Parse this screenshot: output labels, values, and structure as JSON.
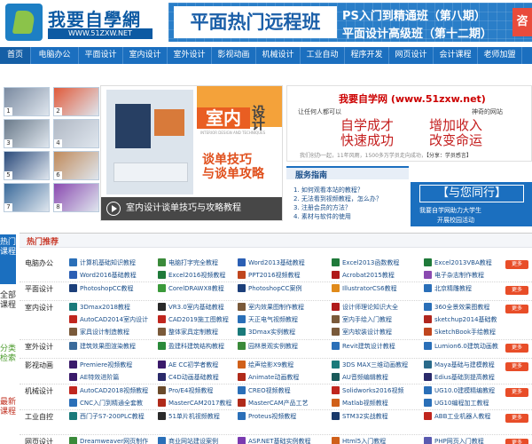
{
  "header": {
    "logo_title": "我要自學網",
    "logo_url": "WWW.51ZXW.NET",
    "banner_main": "平面热门远程班",
    "banner_line1": "PS入门到精通班（第八期）",
    "banner_line2": "平面设计高级班（第十二期）",
    "banner_badge": "咨"
  },
  "nav": [
    "首页",
    "电脑办公",
    "平面设计",
    "室内设计",
    "室外设计",
    "影视动画",
    "机械设计",
    "工业自动",
    "程序开发",
    "网页设计",
    "会计课程",
    "老师加盟",
    "学习辅"
  ],
  "thumb_numbers": [
    "1",
    "2",
    "3",
    "4",
    "5",
    "6",
    "7",
    "8"
  ],
  "slide": {
    "tag": "室内",
    "tag2": "设计",
    "subtitle": "INTERIOR DESIGN AND TECHNIQUES",
    "title1": "谈单技巧",
    "title2": "与谈单攻略",
    "caption": "室内设计谈单技巧与攻略教程"
  },
  "promo": {
    "title": "我要自学网 (www.51zxw.net)",
    "left_label": "让任何人都可以",
    "right_label": "神奇的网站",
    "big1": "自学成才",
    "big2": "快速成功",
    "big3": "增加收入",
    "big4": "改变命运",
    "foot": "我们创办一起，11年风雨，1500多万学员走向成功，",
    "foot_bold": "【分享：学员感言】"
  },
  "service": {
    "title": "服务指南",
    "items": [
      "1. 如何观看本站的教程？",
      "2. 无法看到视频教程，怎么办？",
      "3. 注册会员的方法？",
      "4. 素材与软件的使用"
    ]
  },
  "together": {
    "title": "【与您同行】",
    "line1": "我要自学网助力大学生",
    "line2": "开展校园活动"
  },
  "side_tabs": [
    "热门课程",
    "全部课程",
    "分类检索",
    "最新课程"
  ],
  "hot": {
    "title": "热门推荐",
    "more_label": "更多",
    "rows": [
      {
        "cat": "电脑办公",
        "items": [
          [
            "计算机基础知识教程",
            "#2a6fb8"
          ],
          [
            "电脑打字完全教程",
            "#3a8a3a"
          ],
          [
            "Word2013基础教程",
            "#2b5fb4"
          ],
          [
            "Excel2013函数教程",
            "#1f7a3a"
          ],
          [
            "Excel2013VBA教程",
            "#1f7a3a"
          ],
          [
            "Word2016基础教程",
            "#2b5fb4"
          ],
          [
            "Excel2016视频教程",
            "#1f7a3a"
          ],
          [
            "PPT2016视频教程",
            "#c0461e"
          ],
          [
            "Acrobat2015教程",
            "#b01a1a"
          ],
          [
            "电子杂志制作教程",
            "#8a4ab0"
          ]
        ]
      },
      {
        "cat": "平面设计",
        "items": [
          [
            "PhotoshopCC教程",
            "#1c3f7a"
          ],
          [
            "CorelDRAWX8教程",
            "#3a9a3a"
          ],
          [
            "PhotoshopCC案例",
            "#1c3f7a"
          ],
          [
            "IllustratorCS6教程",
            "#e08a1a"
          ],
          [
            "北京精雕教程",
            "#2a6fb8"
          ]
        ]
      },
      {
        "cat": "室内设计",
        "items": [
          [
            "3Dmax2018教程",
            "#1a7a7a"
          ],
          [
            "VR3.0室内基础教程",
            "#2a2a2a"
          ],
          [
            "室内效果图制作教程",
            "#7a5a3a"
          ],
          [
            "设计师理论知识大全",
            "#b01a1a"
          ],
          [
            "360全景效果图教程",
            "#2a6fb8"
          ],
          [
            "AutoCAD2014室内设计",
            "#c0261e"
          ],
          [
            "CAD2019施工图教程",
            "#c0261e"
          ],
          [
            "天正电气视频教程",
            "#2a6fb8"
          ],
          [
            "室内手绘入门教程",
            "#7a5a3a"
          ],
          [
            "sketchup2014基础教",
            "#b0261e"
          ],
          [
            "家具设计制造教程",
            "#7a5a3a"
          ],
          [
            "整体家具定制教程",
            "#7a5a3a"
          ],
          [
            "3Dmax实例教程",
            "#1a7a7a"
          ],
          [
            "室内软装设计教程",
            "#7a5a3a"
          ],
          [
            "SketchBook手绘教程",
            "#c0461e"
          ]
        ]
      },
      {
        "cat": "室外设计",
        "items": [
          [
            "建筑效果图渲染教程",
            "#3a6a9a"
          ],
          [
            "盈建科建筑结构教程",
            "#2a8a3a"
          ],
          [
            "园林景观实例教程",
            "#3a8a3a"
          ],
          [
            "Revit建筑设计教程",
            "#2a6fb8"
          ],
          [
            "Lumion6.0建筑动画教",
            "#2a6fb8"
          ]
        ]
      },
      {
        "cat": "影视动画",
        "items": [
          [
            "Premiere视频教程",
            "#3a1a6a"
          ],
          [
            "AE CC初学者教程",
            "#3a1a6a"
          ],
          [
            "绘声绘影X9教程",
            "#d0601a"
          ],
          [
            "3DS MAX三维动画教程",
            "#1a7a7a"
          ],
          [
            "Maya基础与建模教程",
            "#2a6a8a"
          ],
          [
            "AE特效进阶篇",
            "#3a1a6a"
          ],
          [
            "C4D动画基础教程",
            "#2a2a6a"
          ],
          [
            "Animate动画教程",
            "#b02a1a"
          ],
          [
            "AU音频编辑教程",
            "#1a5a5a"
          ],
          [
            "Edius基础到提高教程",
            "#2a2a6a"
          ]
        ]
      },
      {
        "cat": "机械设计",
        "items": [
          [
            "AutoCAD2018视频教程",
            "#c0261e"
          ],
          [
            "Pro/E4视频教程",
            "#6a4a2a"
          ],
          [
            "CREO视频教程",
            "#2a6fb8"
          ],
          [
            "Solidworks2016视频",
            "#c0261e"
          ],
          [
            "UG10.0建模精编教程",
            "#2a6fb8"
          ],
          [
            "CNC入门到精通全套教",
            "#2a6fb8"
          ],
          [
            "MasterCAM2017教程",
            "#b02a1a"
          ],
          [
            "MasterCAM产品工艺",
            "#b02a1a"
          ],
          [
            "Matlab视频教程",
            "#d0601a"
          ],
          [
            "UG10编程加工教程",
            "#2a6fb8"
          ]
        ]
      },
      {
        "cat": "工业自控",
        "items": [
          [
            "西门子S7-200PLC教程",
            "#1a7a7a"
          ],
          [
            "51单片机视频教程",
            "#2a2a2a"
          ],
          [
            "Proteus视频教程",
            "#2a6fb8"
          ],
          [
            "STM32实战教程",
            "#1a3a6a"
          ],
          [
            "ABB工业机器人教程",
            "#c0261e"
          ]
        ]
      },
      {
        "cat": "网页设计",
        "items": [
          [
            "Dreamweaver网页制作",
            "#3a8a3a"
          ],
          [
            "商业网站建设案例",
            "#2a6fb8"
          ],
          [
            "ASP.NET基础实例教程",
            "#7a3ab0"
          ],
          [
            "Html5入门教程",
            "#d0601a"
          ],
          [
            "PHP网页入门教程",
            "#5a5ab0"
          ]
        ]
      }
    ]
  }
}
